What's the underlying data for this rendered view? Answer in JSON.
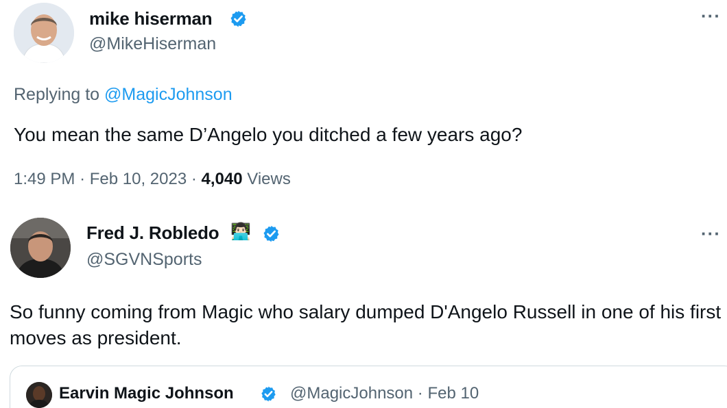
{
  "tweet1": {
    "name": "mike hiserman",
    "handle": "@MikeHiserman",
    "replying_prefix": "Replying to",
    "replying_to": "@MagicJohnson",
    "text": "You mean the same D’Angelo you ditched a few years ago?",
    "time": "1:49 PM",
    "sep1": "·",
    "date": "Feb 10, 2023",
    "sep2": "·",
    "views_count": "4,040",
    "views_label": "Views",
    "more": "···"
  },
  "tweet2": {
    "name": "Fred J. Robledo",
    "emoji": "👨🏻‍💻",
    "handle": "@SGVNSports",
    "text": "So funny coming from Magic who salary dumped D'Angelo Russell in one of his first moves as president.",
    "more": "···"
  },
  "quote": {
    "name": "Earvin Magic Johnson",
    "handle": "@MagicJohnson",
    "sep": "·",
    "date": "Feb 10"
  },
  "colors": {
    "verified": "#1d9bf0",
    "link": "#1d9bf0",
    "secondary_text": "#536471",
    "border": "#cfd9de"
  }
}
